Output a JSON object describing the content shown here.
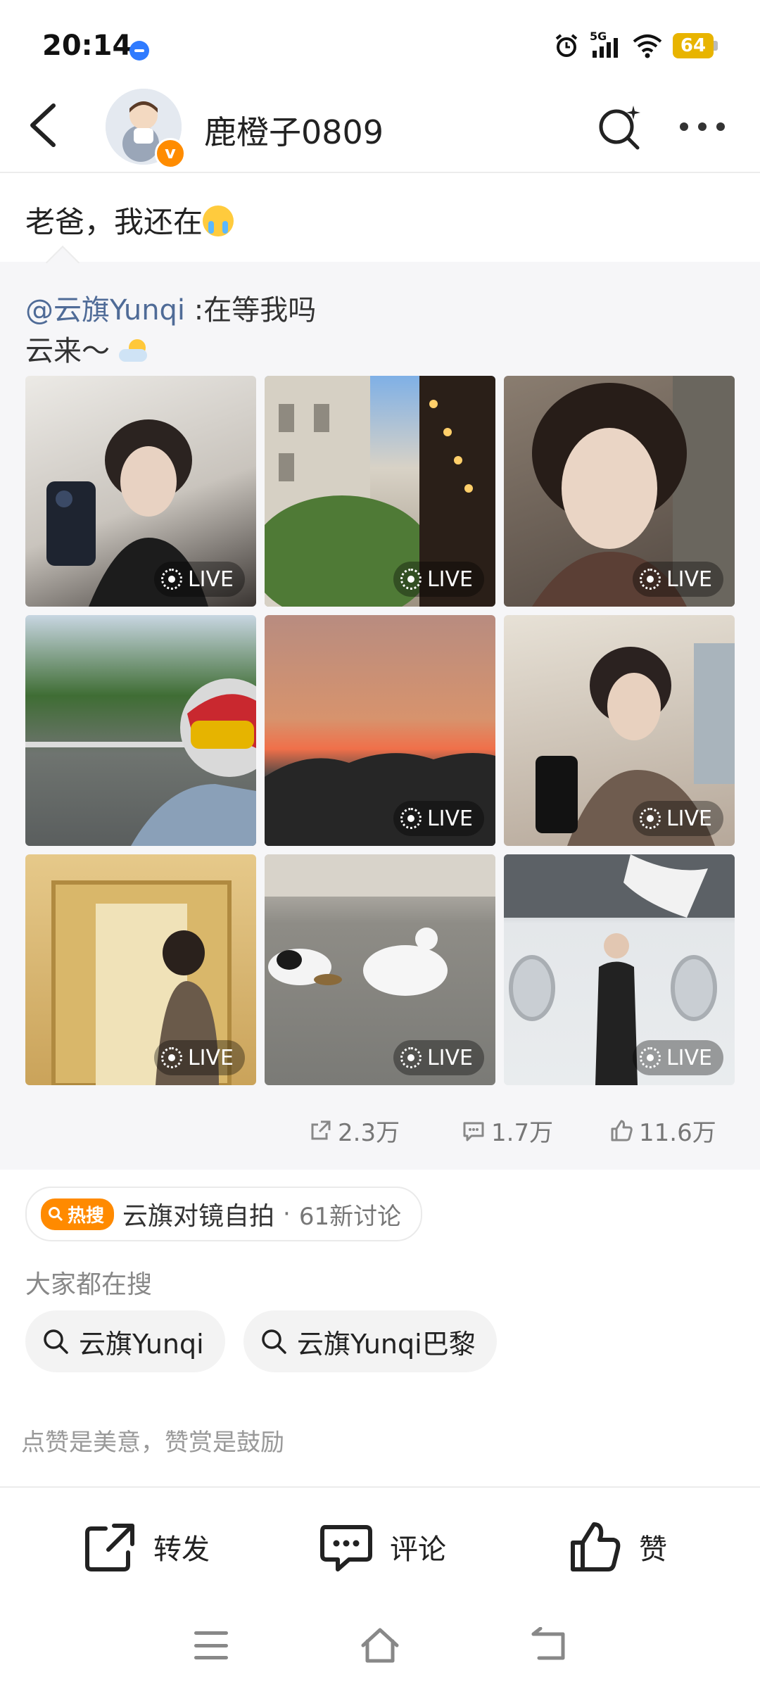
{
  "status_bar": {
    "time": "20:14",
    "battery": "64",
    "network": "5G"
  },
  "header": {
    "username": "鹿橙子0809"
  },
  "post": {
    "text": "老爸，我还在"
  },
  "repost": {
    "mention": "@云旗Yunqi",
    "text": " :在等我吗",
    "line2": "云来～",
    "photos": [
      {
        "live_label": "LIVE"
      },
      {
        "live_label": "LIVE"
      },
      {
        "live_label": "LIVE"
      },
      {
        "live_label": ""
      },
      {
        "live_label": "LIVE"
      },
      {
        "live_label": "LIVE"
      },
      {
        "live_label": "LIVE"
      },
      {
        "live_label": "LIVE"
      },
      {
        "live_label": "LIVE"
      }
    ],
    "stats": {
      "reposts": "2.3万",
      "comments": "1.7万",
      "likes": "11.6万"
    }
  },
  "hot_search": {
    "badge": "热搜",
    "topic": "云旗对镜自拍",
    "separator": "·",
    "count": "61新讨论"
  },
  "search_section": {
    "label": "大家都在搜",
    "chips": [
      "云旗Yunqi",
      "云旗Yunqi巴黎"
    ]
  },
  "encourage_text": "点赞是美意，赞赏是鼓励",
  "actions": {
    "repost": "转发",
    "comment": "评论",
    "like": "赞"
  },
  "colors": {
    "mention": "#4f6b97",
    "hot_orange": "#ff8a00",
    "battery": "#e8b400"
  }
}
